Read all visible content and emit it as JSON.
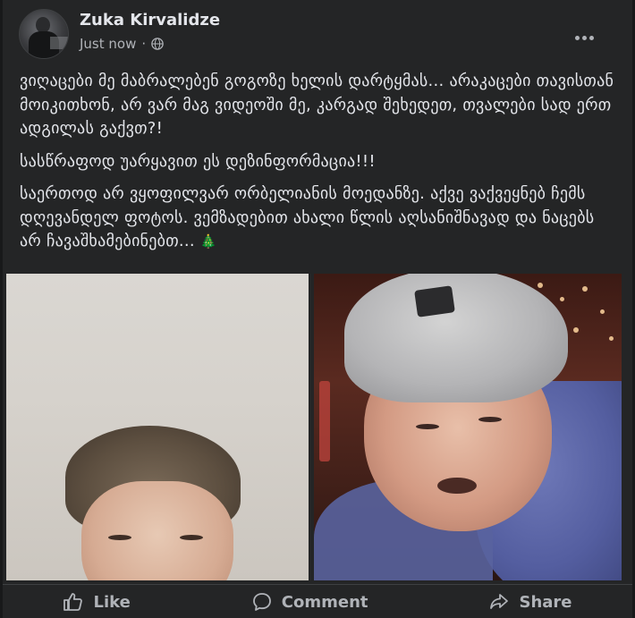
{
  "post": {
    "author": "Zuka Kirvalidze",
    "timestamp": "Just now",
    "paragraphs": [
      "ვიღაცები მე მაბრალებენ გოგოზე ხელის დარტყმას... არაკაცები თავისთან მოიკითხონ, არ ვარ მაგ ვიდეოში მე, კარგად შეხედეთ, თვალები სად ერთ ადგილას გაქვთ?!",
      "სასწრაფოდ უარყავით ეს დეზინფორმაცია!!!",
      "საერთოდ არ ვყოფილვარ ორბელიანის მოედანზე. აქვე ვაქვეყნებ ჩემს დღევანდელ ფოტოს. ვემზადებით ახალი წლის აღსანიშნავად და ნაცებს არ ჩავაშხამებინებთ..."
    ],
    "emoji": "🎄"
  },
  "actions": {
    "like": "Like",
    "comment": "Comment",
    "share": "Share"
  },
  "icons": {
    "menu": "more-horizontal-icon",
    "privacy": "globe-icon",
    "like": "thumbs-up-icon",
    "comment": "comment-bubble-icon",
    "share": "share-arrow-icon"
  },
  "colors": {
    "background": "#18191a",
    "card": "#242526",
    "text_primary": "#e4e6eb",
    "text_secondary": "#b0b3b8"
  }
}
